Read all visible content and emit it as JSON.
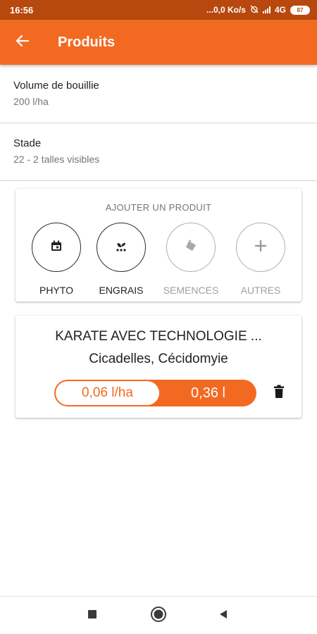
{
  "status_bar": {
    "time": "16:56",
    "network_speed": "...0,0 Ko/s",
    "network_type": "4G",
    "battery": "87"
  },
  "app_bar": {
    "title": "Produits",
    "back_icon": "arrow-left-icon",
    "color": "#f26a22"
  },
  "volume": {
    "label": "Volume de bouillie",
    "value": "200 l/ha"
  },
  "stage": {
    "label": "Stade",
    "value": "22 - 2 talles visibles"
  },
  "add_product": {
    "title": "AJOUTER UN PRODUIT",
    "categories": [
      {
        "label": "PHYTO",
        "icon": "calendar-icon",
        "enabled": true
      },
      {
        "label": "ENGRAIS",
        "icon": "sprout-icon",
        "enabled": true
      },
      {
        "label": "SEMENCES",
        "icon": "seed-bag-icon",
        "enabled": false
      },
      {
        "label": "AUTRES",
        "icon": "plus-icon",
        "enabled": false
      }
    ]
  },
  "product": {
    "name": "KARATE AVEC TECHNOLOGIE ...",
    "targets": "Cicadelles, Cécidomyie",
    "dose_rate": "0,06 l/ha",
    "dose_total": "0,36 l",
    "delete_icon": "trash-icon"
  },
  "nav_bar": {
    "icons": [
      "square-icon",
      "circle-icon",
      "triangle-back-icon"
    ]
  }
}
